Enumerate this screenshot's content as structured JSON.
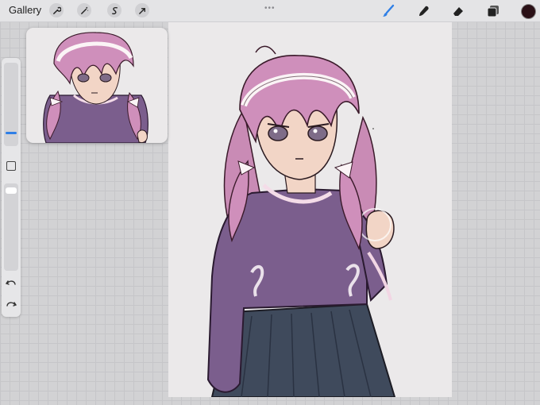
{
  "topbar": {
    "gallery_label": "Gallery",
    "left_tools": [
      "wrench-icon",
      "magic-wand-icon",
      "selection-icon",
      "transform-arrow-icon"
    ],
    "right_tools": [
      "brush-icon",
      "smudge-icon",
      "eraser-icon",
      "layers-icon"
    ],
    "active_tool": "brush-icon",
    "grabber": "•••"
  },
  "colors": {
    "current_color": "#2a1016",
    "active_tool_accent": "#2f7fe6"
  },
  "sidebar": {
    "brush_size_fraction": 0.1,
    "opacity_fraction": 0.05,
    "buttons": [
      "modify-button",
      "undo-icon",
      "redo-icon"
    ]
  }
}
